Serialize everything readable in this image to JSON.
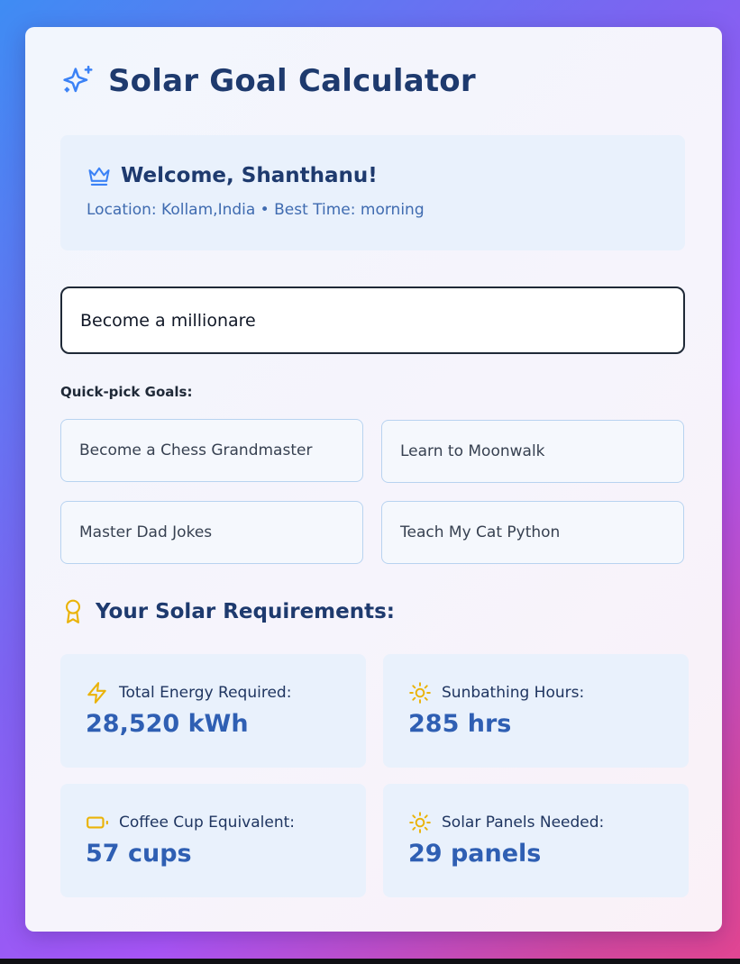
{
  "header": {
    "title": "Solar Goal Calculator",
    "icon": "sparkles-icon"
  },
  "welcome": {
    "greeting": "Welcome, Shanthanu!",
    "subtitle": "Location: Kollam,India • Best Time: morning",
    "icon": "crown-icon"
  },
  "goal_input": {
    "value": "Become a millionare"
  },
  "quick_picks": {
    "label": "Quick-pick Goals:",
    "items": [
      "Become a Chess Grandmaster",
      "Learn to Moonwalk",
      "Master Dad Jokes",
      "Teach My Cat Python"
    ]
  },
  "requirements": {
    "title": "Your Solar Requirements:",
    "icon": "award-icon",
    "stats": [
      {
        "label": "Total Energy Required:",
        "value": "28,520 kWh",
        "icon": "zap-icon"
      },
      {
        "label": "Sunbathing Hours:",
        "value": "285 hrs",
        "icon": "sun-icon"
      },
      {
        "label": "Coffee Cup Equivalent:",
        "value": "57 cups",
        "icon": "battery-icon"
      },
      {
        "label": "Solar Panels Needed:",
        "value": "29 panels",
        "icon": "sun-icon"
      }
    ]
  },
  "colors": {
    "accent": "#2f5fb3",
    "heading": "#1e3a6e",
    "icon_blue": "#3b82f6",
    "icon_amber": "#eab308"
  }
}
